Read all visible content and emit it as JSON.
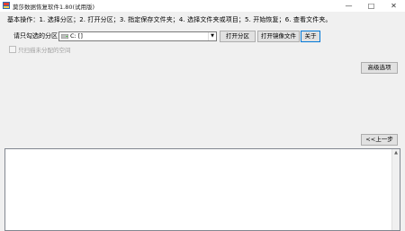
{
  "window": {
    "title": "莫莎数据恢复软件1.80(试用版)",
    "minimize": "—",
    "maximize": "□",
    "close": "✕"
  },
  "steps": "基本操作：1. 选择分区；2. 打开分区；3. 指定保存文件夹；4. 选择文件夹或项目；5. 开始恢复；6. 查看文件夹。",
  "partition": {
    "label": "请只勾选的分区：",
    "drive_value": "C: []"
  },
  "buttons": {
    "open_partition": "打开分区",
    "open_image": "打开镜像文件",
    "about": "关于",
    "advanced": "高级选项",
    "prev": "<<上一步"
  },
  "checkbox": {
    "label": "只扫描未分配的空间"
  }
}
